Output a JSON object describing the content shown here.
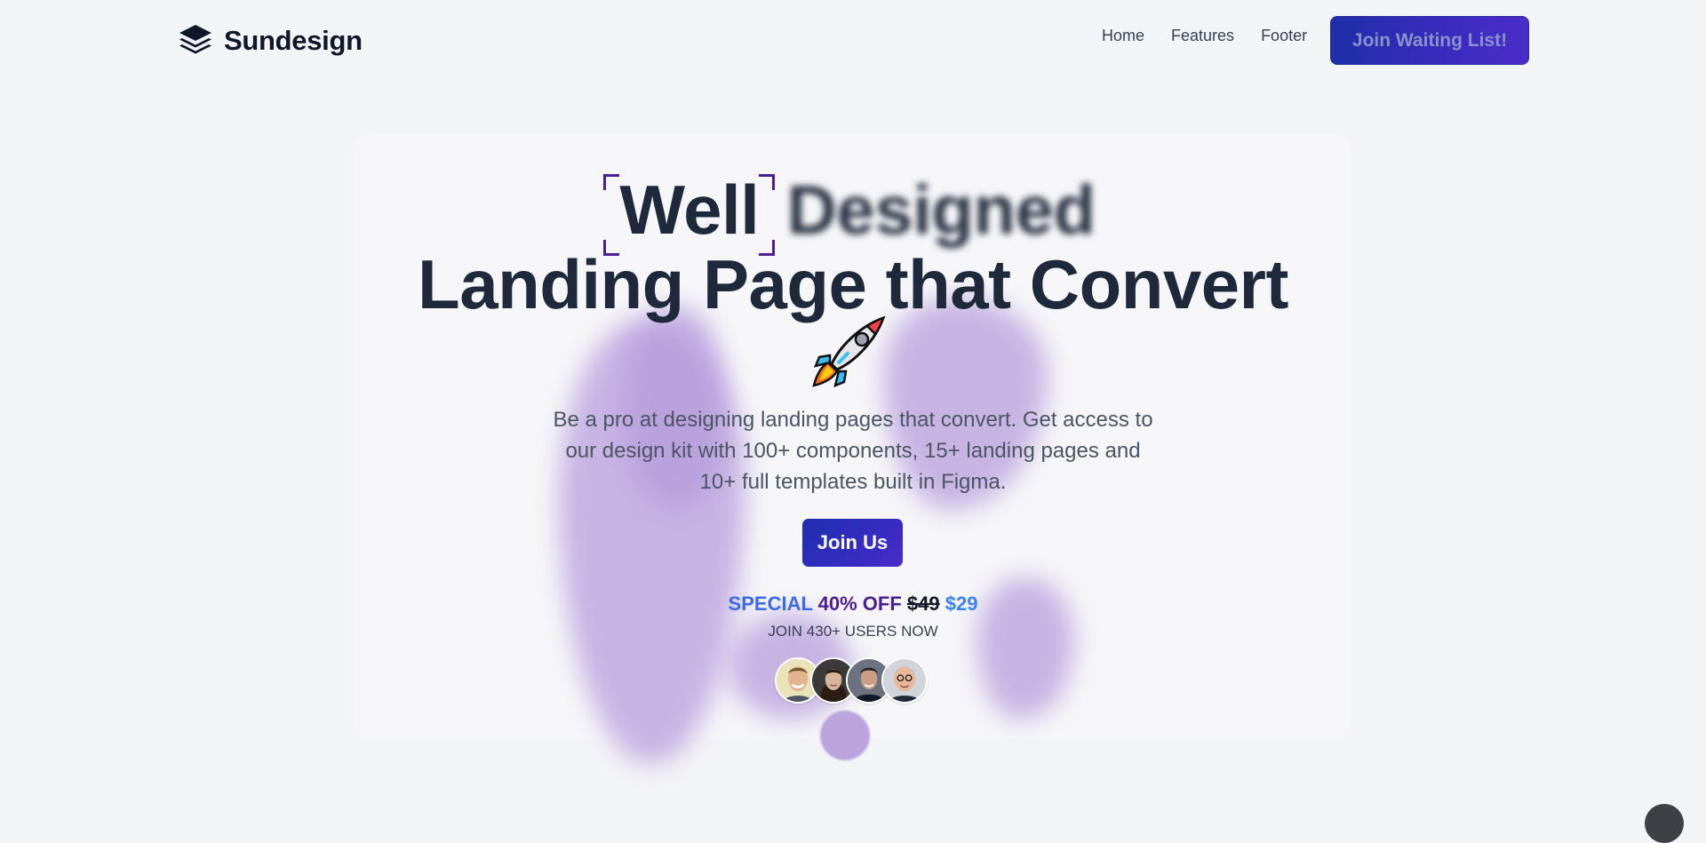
{
  "header": {
    "brand": "Sundesign",
    "nav": [
      {
        "label": "Home"
      },
      {
        "label": "Features"
      },
      {
        "label": "Footer"
      }
    ],
    "cta_label": "Join Waiting List!"
  },
  "hero": {
    "headline_word1": "Well",
    "headline_word2": "Designed",
    "headline_line2": "Landing Page that Convert",
    "subtext_lines": [
      "Be a pro at designing landing pages that convert. Get access to",
      "our design kit with 100+ components, 15+ landing pages and",
      "10+ full templates built in Figma."
    ],
    "join_button": "Join Us",
    "offer": {
      "special": "SPECIAL",
      "off": "40% OFF",
      "old_price": "$49",
      "new_price": "$29"
    },
    "join_count": "JOIN 430+ USERS NOW"
  },
  "icons": {
    "logo": "layers-icon",
    "rocket": "rocket-icon"
  },
  "colors": {
    "background": "#f3f4f6",
    "card": "#f6f6f8",
    "accent_gradient_start": "#1e2fa8",
    "accent_gradient_end": "#4b2cc9",
    "blob": "#b59bdc",
    "price_blue": "#3b82f6",
    "off_purple": "#4c1d95"
  }
}
